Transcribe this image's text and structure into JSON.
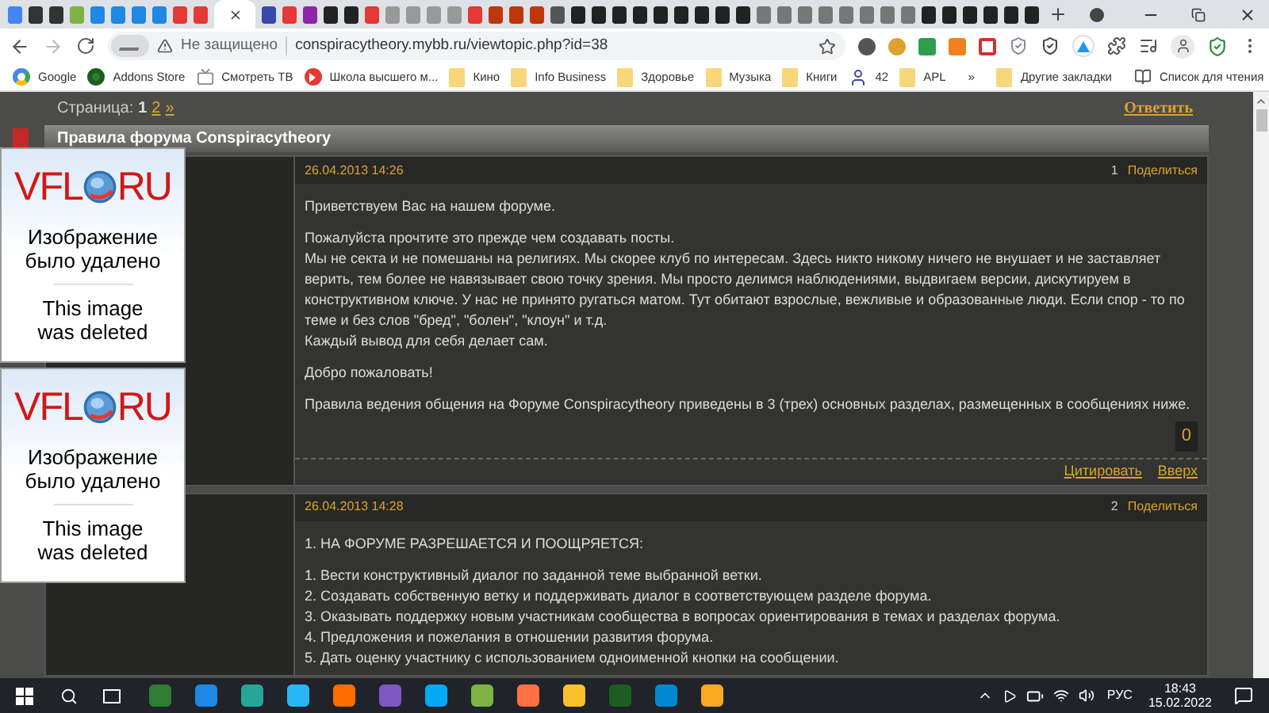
{
  "address_bar": {
    "security": "Не защищено",
    "url": "conspiracytheory.mybb.ru/viewtopic.php?id=38"
  },
  "bookmarks": [
    {
      "label": "Google",
      "kind": "google"
    },
    {
      "label": "Addons Store",
      "kind": "addons"
    },
    {
      "label": "Смотреть ТВ",
      "kind": "tv"
    },
    {
      "label": "Школа высшего м...",
      "kind": "play"
    },
    {
      "label": "Кино",
      "kind": "folder"
    },
    {
      "label": "Info Business",
      "kind": "folder"
    },
    {
      "label": "Здоровье",
      "kind": "folder"
    },
    {
      "label": "Музыка",
      "kind": "folder"
    },
    {
      "label": "Книги",
      "kind": "folder"
    },
    {
      "label": "42",
      "kind": "person"
    },
    {
      "label": "APL",
      "kind": "folder"
    }
  ],
  "bookmarks_more": "»",
  "other_bookmarks": "Другие закладки",
  "reading_list": "Список для чтения",
  "pagination": {
    "label": "Страница:",
    "pages": [
      {
        "label": "1",
        "selected": true
      },
      {
        "label": "2",
        "selected": false
      }
    ],
    "next": "»"
  },
  "reply_link": "Ответить",
  "topic_title": "Правила форума Conspiracytheory",
  "posts": [
    {
      "date": "26.04.2013 14:26",
      "number": "1",
      "share": "Поделиться",
      "paragraphs": [
        [
          "Приветствуем Вас на нашем форуме."
        ],
        [
          "Пожалуйста прочтите это прежде чем создавать посты.",
          "Мы не секта и не помешаны на религиях. Мы скорее клуб по интересам. Здесь никто никому ничего не внушает и не заставляет верить, тем более не навязывает свою точку зрения. Мы просто делимся наблюдениями, выдвигаем версии, дискутируем в конструктивном ключе. У нас не принято ругаться матом. Тут обитают взрослые, вежливые и образованные люди. Если спор - то по теме и без слов \"бред\", \"болен\", \"клоун\" и т.д.",
          "Каждый вывод для себя делает сам."
        ],
        [
          "Добро пожаловать!"
        ],
        [
          "Правила ведения общения на Форуме Conspiracytheory приведены в 3 (трех) основных разделах, размещенных в сообщениях ниже."
        ]
      ],
      "rating": "0",
      "quote": "Цитировать",
      "top": "Вверх"
    },
    {
      "date": "26.04.2013 14:28",
      "number": "2",
      "share": "Поделиться",
      "paragraphs": [
        [
          "1. НА ФОРУМЕ РАЗРЕШАЕТСЯ И ПООЩРЯЕТСЯ:"
        ],
        [
          "1. Вести конструктивный диалог по заданной теме выбранной ветки.",
          "2. Создавать собственную ветку и поддерживать диалог в соответствующем разделе форума.",
          "3. Оказывать поддержку новым участникам сообщества в вопросах ориентирования в темах и разделах форума.",
          "4. Предложения и пожелания в отношении развития форума.",
          "5. Дать оценку участнику с использованием одноименной кнопки на сообщении."
        ]
      ]
    }
  ],
  "deleted_images": [
    {
      "logo_left": "VFL",
      "logo_right": "RU",
      "notice": "Изображение было удалено",
      "notice_en": "This image was deleted"
    },
    {
      "logo_left": "VFL",
      "logo_right": "RU",
      "notice": "Изображение было удалено",
      "notice_en": "This image was deleted"
    }
  ],
  "taskbar": {
    "language": "РУС",
    "time": "18:43",
    "date": "15.02.2022"
  }
}
